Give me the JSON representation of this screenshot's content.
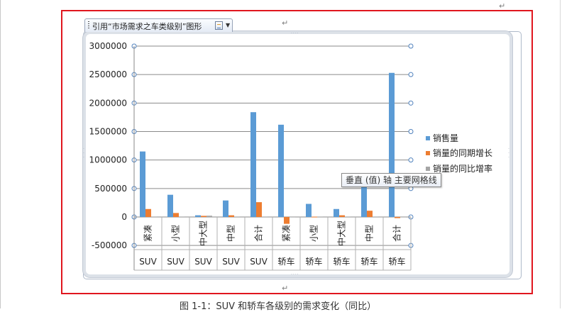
{
  "chart_tab": {
    "label": "引用“市场需求之车类级别”图形",
    "layout_icon": "chart-layout-icon",
    "dropdown_icon": "chevron-down-icon"
  },
  "tooltip": "垂直 (值) 轴 主要网格线",
  "caption": "图 1-1：SUV 和轿车各级别的需求变化（同比）",
  "colors": {
    "sales": "#5b9bd5",
    "growth": "#ed7d31",
    "rate": "#a5a5a5",
    "frame": "#e0161e"
  },
  "chart_data": {
    "type": "bar",
    "yticks": [
      3000000,
      2500000,
      2000000,
      1500000,
      1000000,
      500000,
      0,
      -500000
    ],
    "ytick_labels": [
      "3000000",
      "2500000",
      "2000000",
      "1500000",
      "1000000",
      "500000",
      "0",
      "-500000"
    ],
    "ylim": [
      -500000,
      3000000
    ],
    "categories": [
      "紧凑",
      "小型",
      "中大型",
      "中型",
      "合计",
      "紧凑",
      "小型",
      "中大型",
      "中型",
      "合计"
    ],
    "groups": [
      "SUV",
      "SUV",
      "SUV",
      "SUV",
      "SUV",
      "轿车",
      "轿车",
      "轿车",
      "轿车",
      "轿车"
    ],
    "series": [
      {
        "name": "销售量",
        "values": [
          1150000,
          390000,
          30000,
          290000,
          1840000,
          1620000,
          230000,
          140000,
          590000,
          2530000
        ]
      },
      {
        "name": "销量的同期增长",
        "values": [
          140000,
          70000,
          20000,
          30000,
          260000,
          -120000,
          5000,
          30000,
          110000,
          -20000
        ]
      },
      {
        "name": "销量的同比增率",
        "values": [
          0.14,
          0.22,
          0.9,
          0.12,
          0.16,
          -0.07,
          0.02,
          0.25,
          0.23,
          -0.01
        ]
      }
    ],
    "grid": true,
    "legend": "right"
  }
}
